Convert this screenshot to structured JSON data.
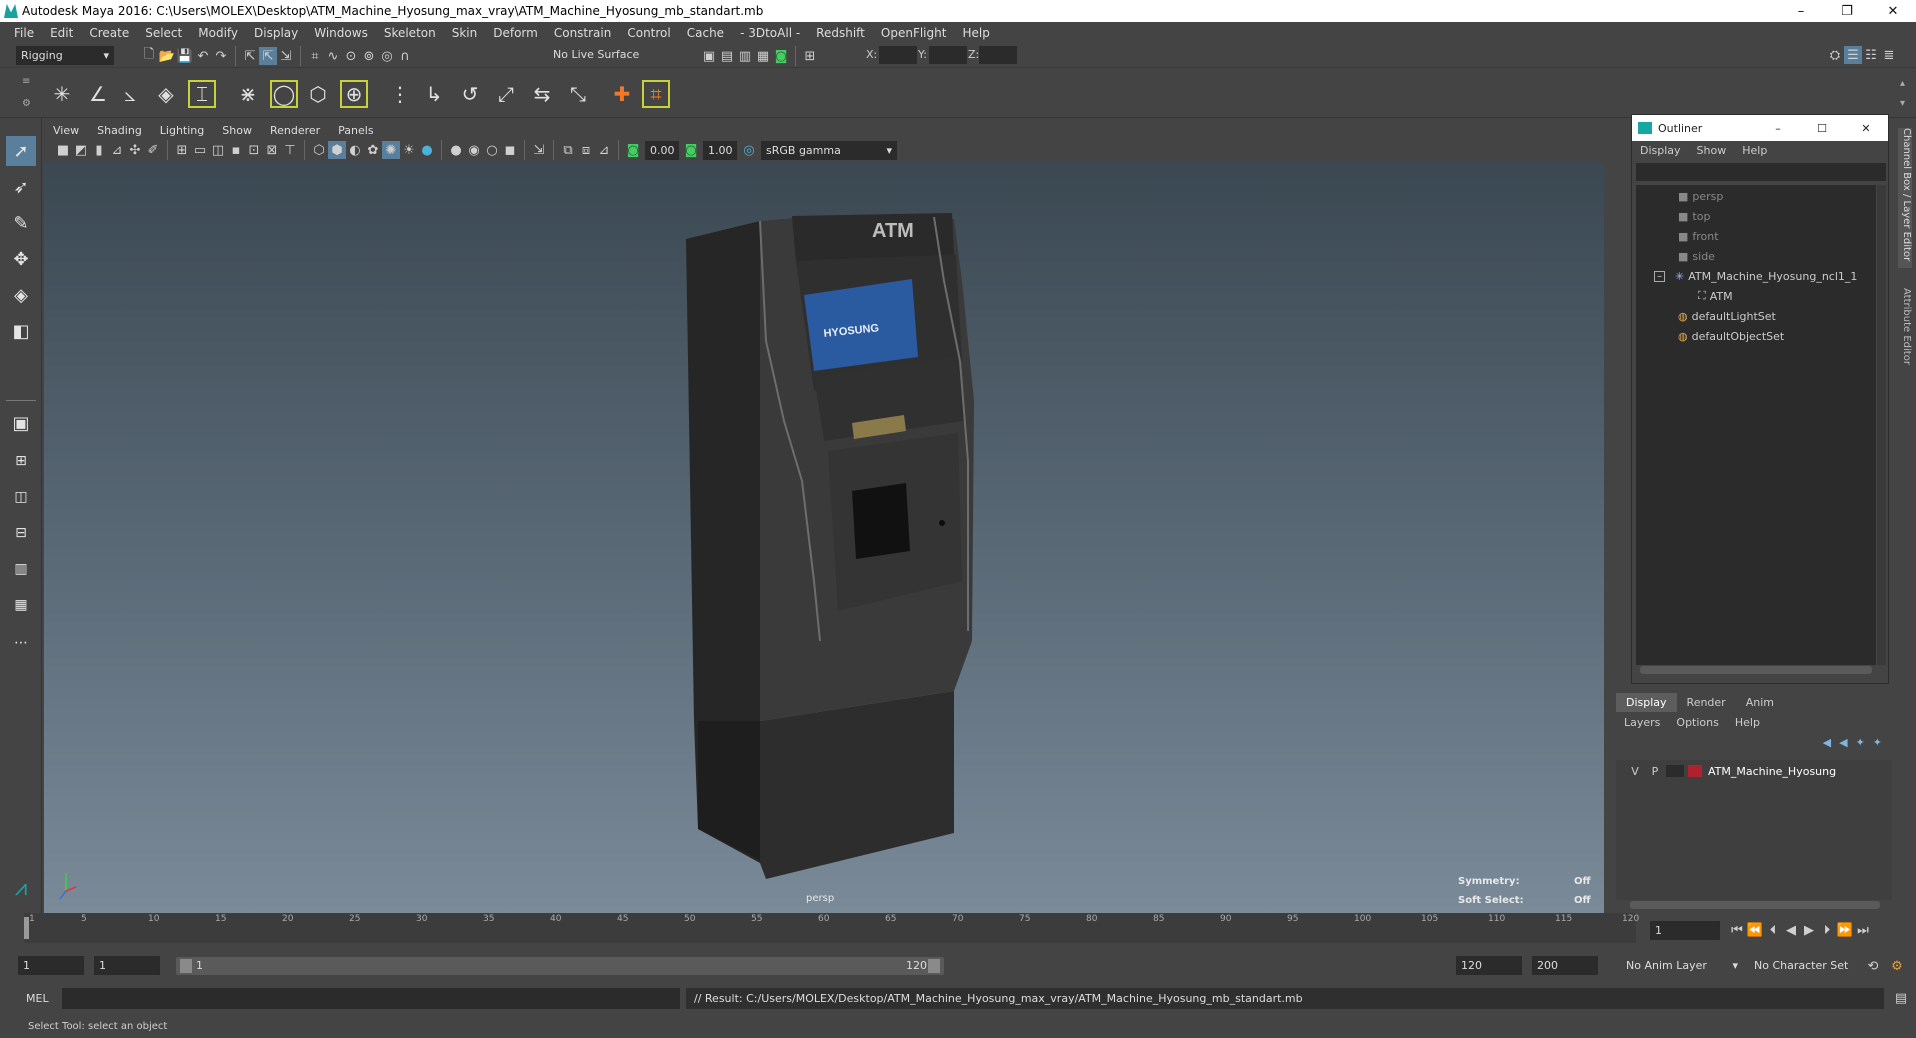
{
  "window": {
    "title": "Autodesk Maya 2016: C:\\Users\\MOLEX\\Desktop\\ATM_Machine_Hyosung_max_vray\\ATM_Machine_Hyosung_mb_standart.mb",
    "minimize": "–",
    "restore": "❐",
    "close": "✕"
  },
  "menubar": [
    "File",
    "Edit",
    "Create",
    "Select",
    "Modify",
    "Display",
    "Windows",
    "Skeleton",
    "Skin",
    "Deform",
    "Constrain",
    "Control",
    "Cache",
    "- 3DtoAll -",
    "Redshift",
    "OpenFlight",
    "Help"
  ],
  "statusline": {
    "mode": "Rigging",
    "live_surface": "No Live Surface",
    "x_label": "X:",
    "y_label": "Y:",
    "z_label": "Z:"
  },
  "viewport": {
    "menu": [
      "View",
      "Shading",
      "Lighting",
      "Show",
      "Renderer",
      "Panels"
    ],
    "exposure": "0.00",
    "gamma": "1.00",
    "colorspace": "sRGB gamma",
    "camera": "persp",
    "symmetry_label": "Symmetry:",
    "symmetry_value": "Off",
    "softselect_label": "Soft Select:",
    "softselect_value": "Off",
    "model_sign": "ATM",
    "model_brand": "HYOSUNG"
  },
  "outliner": {
    "title": "Outliner",
    "menu": [
      "Display",
      "Show",
      "Help"
    ],
    "items": [
      {
        "label": "persp"
      },
      {
        "label": "top"
      },
      {
        "label": "front"
      },
      {
        "label": "side"
      },
      {
        "label": "ATM_Machine_Hyosung_ncl1_1"
      },
      {
        "label": "ATM"
      },
      {
        "label": "defaultLightSet"
      },
      {
        "label": "defaultObjectSet"
      }
    ]
  },
  "side_tabs": [
    "Channel Box / Layer Editor",
    "Attribute Editor"
  ],
  "layer_editor": {
    "tabs": [
      "Display",
      "Render",
      "Anim"
    ],
    "menu": [
      "Layers",
      "Options",
      "Help"
    ],
    "layer": {
      "v": "V",
      "p": "P",
      "name": "ATM_Machine_Hyosung",
      "color": "#b0202e"
    }
  },
  "timeline": {
    "ticks": [
      "1",
      "5",
      "10",
      "15",
      "20",
      "25",
      "30",
      "35",
      "40",
      "45",
      "50",
      "55",
      "60",
      "65",
      "70",
      "75",
      "80",
      "85",
      "90",
      "95",
      "100",
      "105",
      "110",
      "115",
      "120"
    ],
    "current_frame": "1"
  },
  "range": {
    "start": "1",
    "playback_start": "1",
    "slider_start": "1",
    "slider_end": "120",
    "playback_end": "120",
    "end": "200",
    "anim_layer": "No Anim Layer",
    "char_set": "No Character Set"
  },
  "command": {
    "lang": "MEL",
    "result": "// Result: C:/Users/MOLEX/Desktop/ATM_Machine_Hyosung_max_vray/ATM_Machine_Hyosung_mb_standart.mb"
  },
  "helpline": "Select Tool: select an object",
  "colors": {
    "accent": "#16a7a5",
    "viewport_top": "#3b4852",
    "viewport_bottom": "#7a8a98"
  }
}
